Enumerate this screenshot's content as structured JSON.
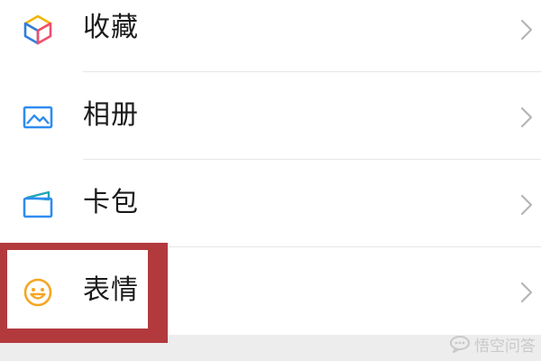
{
  "menu": {
    "items": [
      {
        "label": "收藏",
        "icon": "cube-icon"
      },
      {
        "label": "相册",
        "icon": "photo-album-icon"
      },
      {
        "label": "卡包",
        "icon": "card-wallet-icon"
      },
      {
        "label": "表情",
        "icon": "smiley-face-icon"
      }
    ]
  },
  "highlight": {
    "color": "#b23a3d",
    "target": "表情"
  },
  "watermark": {
    "text": "悟空问答"
  },
  "colors": {
    "label": "#1b1b1b",
    "chevron": "#b5b5b5",
    "divider": "#e6e6e6",
    "section_gap": "#ededed"
  }
}
